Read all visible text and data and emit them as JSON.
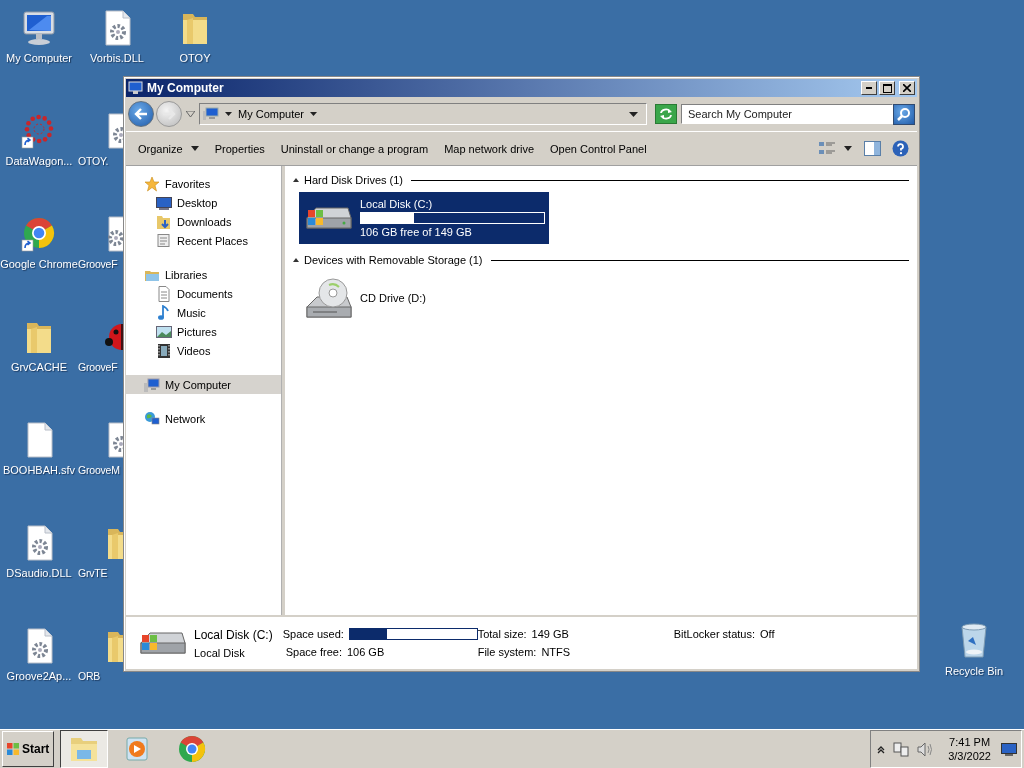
{
  "desktop": {
    "columns": [
      [
        {
          "label": "My Computer",
          "kind": "computer",
          "shortcut": false
        },
        {
          "label": "DataWagon...",
          "kind": "dots",
          "shortcut": true
        },
        {
          "label": "Google Chrome",
          "kind": "chrome",
          "shortcut": true
        },
        {
          "label": "GrvCACHE",
          "kind": "folder",
          "shortcut": false
        },
        {
          "label": "BOOHBAH.sfv",
          "kind": "file",
          "shortcut": false
        },
        {
          "label": "DSaudio.DLL",
          "kind": "gearfile",
          "shortcut": false
        },
        {
          "label": "Groove2Ap...",
          "kind": "gearfile",
          "shortcut": false
        }
      ],
      [
        {
          "label": "Vorbis.DLL",
          "kind": "gearfile",
          "shortcut": false
        },
        {
          "label": "OTOY.",
          "kind": "gearfile",
          "shortcut": false
        },
        {
          "label": "GrooveF",
          "kind": "gearapp",
          "shortcut": false
        },
        {
          "label": "GrooveF",
          "kind": "bug",
          "shortcut": false
        },
        {
          "label": "GrooveM",
          "kind": "gearfile",
          "shortcut": false
        },
        {
          "label": "GrvTE",
          "kind": "folder",
          "shortcut": false
        },
        {
          "label": "ORB",
          "kind": "folder",
          "shortcut": false
        }
      ],
      [
        {
          "label": "OTOY",
          "kind": "folder",
          "shortcut": false
        }
      ]
    ],
    "recycle_bin": {
      "label": "Recycle Bin"
    }
  },
  "window": {
    "title": "My Computer"
  },
  "address_bar": {
    "location": "My Computer",
    "forward_disabled": true
  },
  "search": {
    "placeholder": "Search My Computer"
  },
  "toolbar": {
    "commands": [
      {
        "label": "Organize",
        "dropdown": true
      },
      {
        "label": "Properties",
        "dropdown": false
      },
      {
        "label": "Uninstall or change a program",
        "dropdown": false
      },
      {
        "label": "Map network drive",
        "dropdown": false
      },
      {
        "label": "Open Control Panel",
        "dropdown": false
      }
    ]
  },
  "nav": {
    "groups": [
      {
        "label": "Favorites",
        "kind": "star",
        "selected": false,
        "children": [
          {
            "label": "Desktop",
            "kind": "desktop",
            "selected": false
          },
          {
            "label": "Downloads",
            "kind": "downloads",
            "selected": false
          },
          {
            "label": "Recent Places",
            "kind": "recent",
            "selected": false
          }
        ]
      },
      {
        "label": "Libraries",
        "kind": "library",
        "selected": false,
        "children": [
          {
            "label": "Documents",
            "kind": "document",
            "selected": false
          },
          {
            "label": "Music",
            "kind": "music",
            "selected": false
          },
          {
            "label": "Pictures",
            "kind": "pictures",
            "selected": false
          },
          {
            "label": "Videos",
            "kind": "videos",
            "selected": false
          }
        ]
      },
      {
        "label": "My Computer",
        "kind": "computer",
        "selected": true
      },
      {
        "label": "Network",
        "kind": "network",
        "selected": false
      }
    ]
  },
  "content": {
    "groups": [
      {
        "header": "Hard Disk Drives (1)",
        "items": [
          {
            "kind": "disk",
            "name": "Local Disk (C:)",
            "level": 0.29,
            "caption": "106 GB free of 149 GB",
            "selected": true
          }
        ]
      },
      {
        "header": "Devices with Removable Storage (1)",
        "items": [
          {
            "kind": "cd",
            "name": "CD Drive (D:)",
            "selected": false
          }
        ]
      }
    ]
  },
  "details": {
    "name": "Local Disk (C:)",
    "type": "Local Disk",
    "fields": [
      {
        "label": "Space used:",
        "kind": "bar",
        "level": 0.29
      },
      {
        "label": "Space free:",
        "kind": "text",
        "value": "106 GB"
      },
      {
        "label": "Total size:",
        "kind": "text",
        "value": "149 GB"
      },
      {
        "label": "File system:",
        "kind": "text",
        "value": "NTFS"
      },
      {
        "label": "BitLocker status:",
        "kind": "text",
        "value": "Off"
      }
    ]
  },
  "taskbar": {
    "start": "Start",
    "tasks": [
      {
        "kind": "explorer",
        "selected": true
      },
      {
        "kind": "media",
        "selected": false
      },
      {
        "kind": "chrome",
        "selected": false
      }
    ],
    "time": "7:41 PM",
    "date": "3/3/2022"
  }
}
